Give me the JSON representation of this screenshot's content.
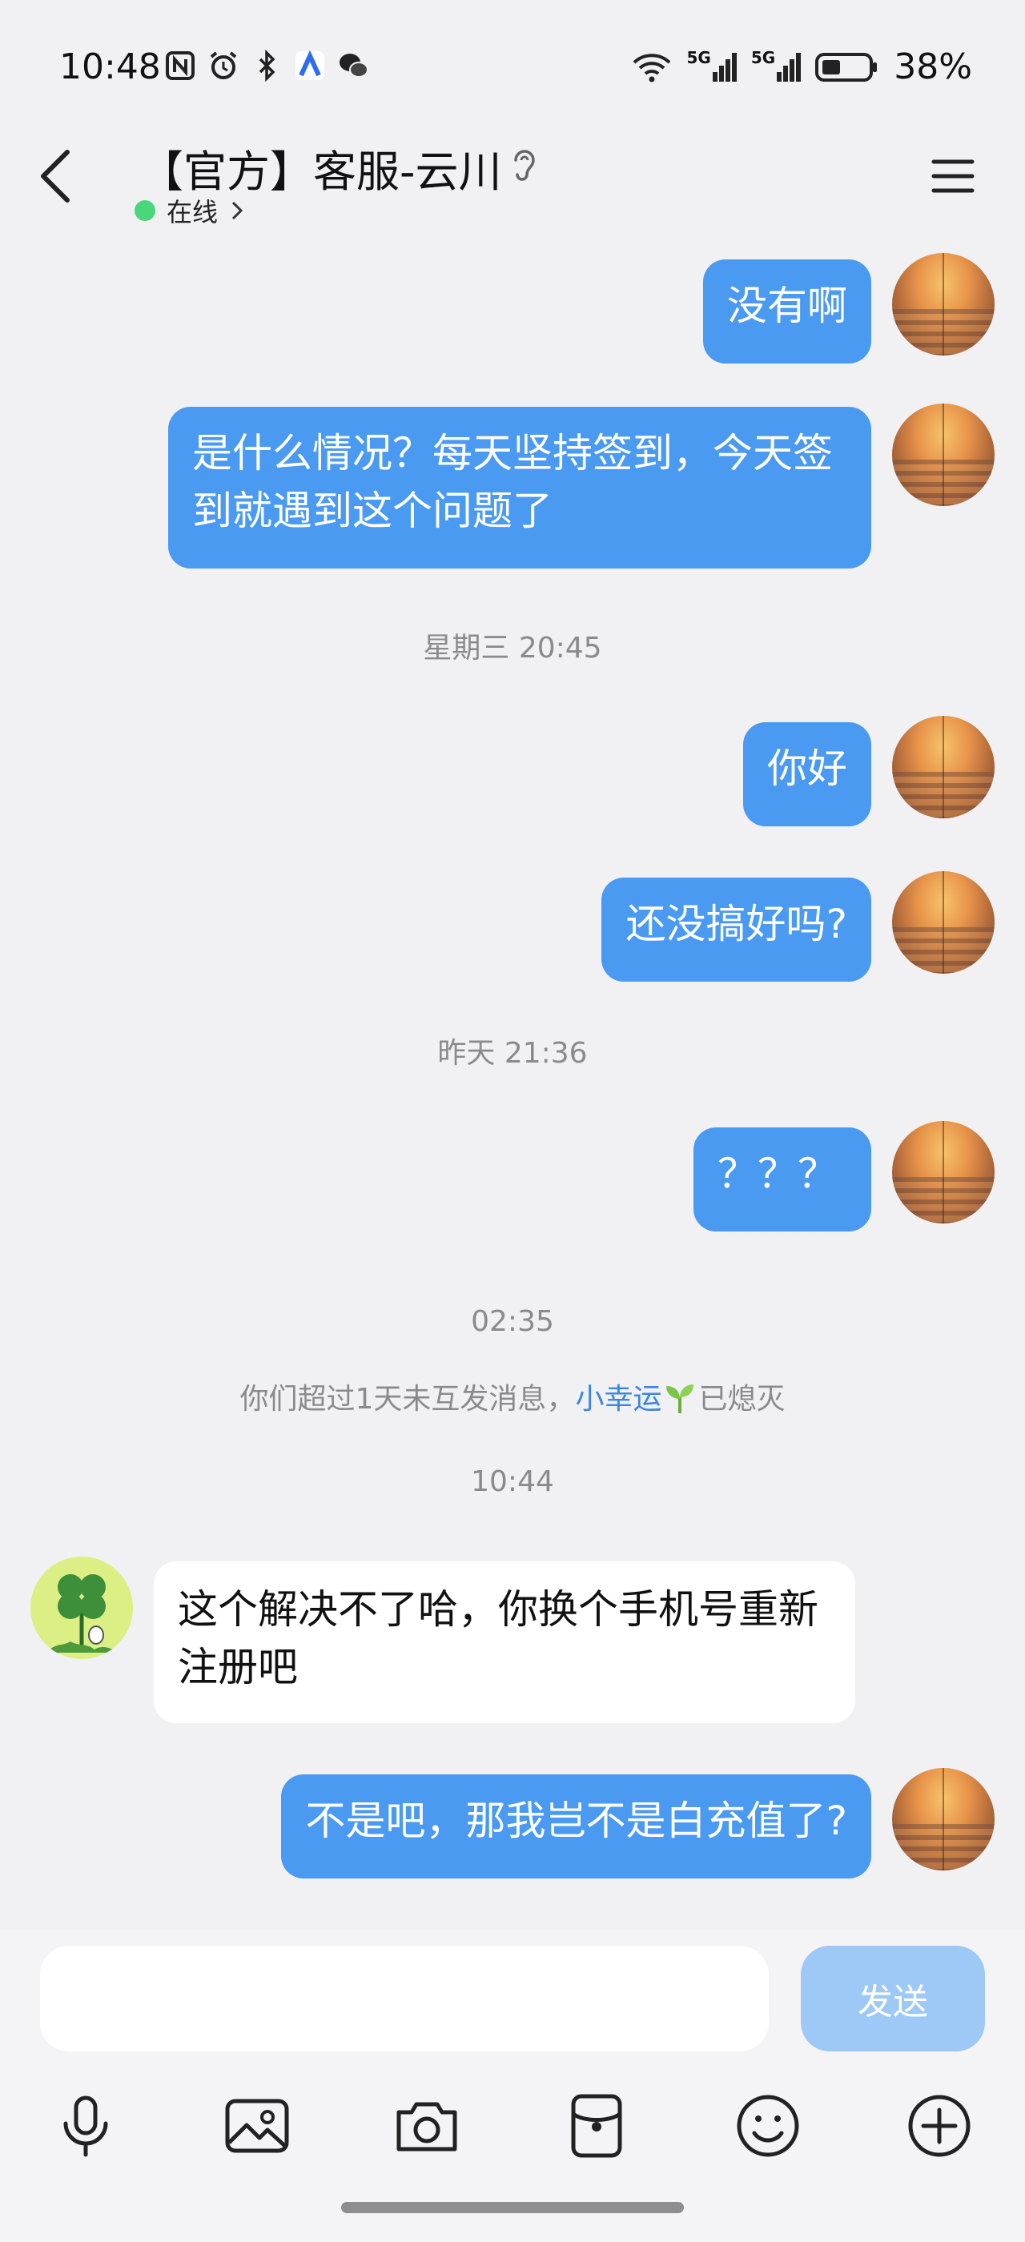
{
  "status_bar": {
    "time": "10:48",
    "battery": "38%",
    "network_1": "5G",
    "network_2": "5G"
  },
  "header": {
    "title": "【官方】客服-云川",
    "status": "在线",
    "status_color": "#4ad67b"
  },
  "messages": [
    {
      "from": "me",
      "text": "没有啊"
    },
    {
      "from": "me",
      "text": "是什么情况？每天坚持签到，今天签到就遇到这个问题了"
    },
    {
      "timestamp": "星期三 20:45"
    },
    {
      "from": "me",
      "text": "你好"
    },
    {
      "from": "me",
      "text": "还没搞好吗?"
    },
    {
      "timestamp": "昨天 21:36"
    },
    {
      "from": "me",
      "text": "？？？"
    },
    {
      "timestamp": "02:35"
    },
    {
      "system": "你们超过1天未互发消息，",
      "system_link": "小幸运",
      "system_suffix": "已熄灭"
    },
    {
      "timestamp": "10:44"
    },
    {
      "from": "other",
      "text": "这个解决不了哈，你换个手机号重新注册吧"
    },
    {
      "from": "me",
      "text": "不是吧，那我岂不是白充值了?"
    }
  ],
  "input": {
    "placeholder": "",
    "send_label": "发送"
  },
  "toolbar": {
    "icons": [
      "mic-icon",
      "image-icon",
      "camera-icon",
      "red-packet-icon",
      "emoji-icon",
      "plus-icon"
    ]
  },
  "colors": {
    "bubble_me": "#4a9af2",
    "bubble_other": "#ffffff",
    "background": "#f1f1f3",
    "send_disabled": "#9ec8f5",
    "link": "#3b86e0"
  }
}
